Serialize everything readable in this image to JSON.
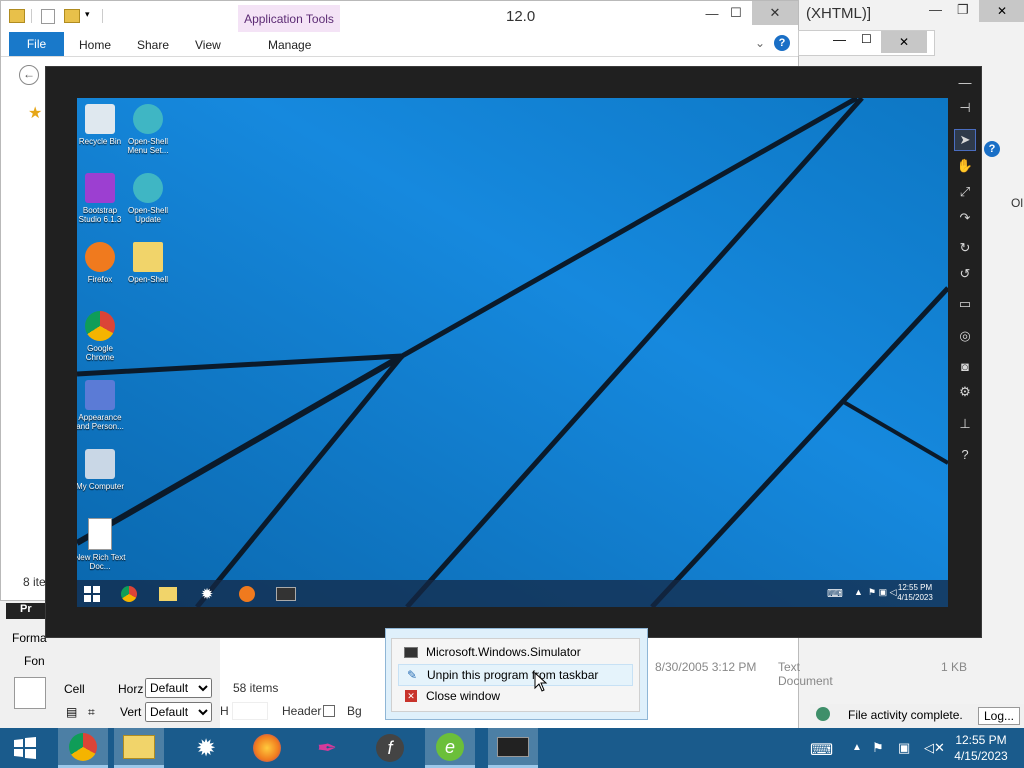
{
  "explorer": {
    "title": "12.0",
    "contextual_tab": "Application Tools",
    "tabs": [
      "File",
      "Home",
      "Share",
      "View",
      "Manage"
    ],
    "items_count_left": "8 ite",
    "status_items": "58 items",
    "file_row": {
      "date": "8/30/2005 3:12 PM",
      "type": "Text Document",
      "size": "1 KB"
    }
  },
  "right_window": {
    "title": "(XHTML)]",
    "status": "File activity complete.",
    "log_button": "Log...",
    "side_text": "Ol"
  },
  "properties_panel": {
    "header": "Pr",
    "format_label": "Forma",
    "font_label": "Fon",
    "cell_label": "Cell",
    "horz_label": "Horz",
    "horz_value": "Default",
    "vert_label": "Vert",
    "vert_value": "Default",
    "h_label": "H",
    "header_label": "Header",
    "bg_label": "Bg"
  },
  "simulator": {
    "desktop_icons": [
      {
        "label": "Recycle Bin",
        "icon": "recycle-bin-icon"
      },
      {
        "label": "Open-Shell Menu Set...",
        "icon": "open-shell-icon"
      },
      {
        "label": "Bootstrap Studio 6.1.3",
        "icon": "bootstrap-studio-icon"
      },
      {
        "label": "Open-Shell Update",
        "icon": "open-shell-update-icon"
      },
      {
        "label": "Firefox",
        "icon": "firefox-icon"
      },
      {
        "label": "Open-Shell",
        "icon": "folder-icon"
      },
      {
        "label": "Google Chrome",
        "icon": "chrome-icon"
      },
      {
        "label": "Appearance and Person...",
        "icon": "appearance-icon"
      },
      {
        "label": "My Computer",
        "icon": "computer-icon"
      },
      {
        "label": "New Rich Text Doc...",
        "icon": "document-icon"
      }
    ],
    "taskbar_clock_time": "12:55 PM",
    "taskbar_clock_date": "4/15/2023"
  },
  "context_menu": {
    "items": [
      {
        "label": "Microsoft.Windows.Simulator",
        "icon": "simulator-icon"
      },
      {
        "label": "Unpin this program from taskbar",
        "icon": "unpin-icon"
      },
      {
        "label": "Close window",
        "icon": "close-window-icon"
      }
    ]
  },
  "taskbar": {
    "time": "12:55 PM",
    "date": "4/15/2023"
  },
  "colors": {
    "taskbar": "#1a5b8c",
    "desktop": "#0f7bc9",
    "file_tab": "#1979ca",
    "app_tools": "#f4e3f6"
  }
}
